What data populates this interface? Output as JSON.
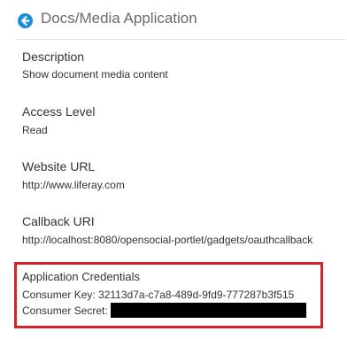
{
  "header": {
    "title": "Docs/Media Application",
    "back_icon": "back-arrow-circle-icon",
    "accent_color": "#1a8fd8"
  },
  "fields": [
    {
      "label": "Description",
      "value": "Show document media content"
    },
    {
      "label": "Access Level",
      "value": "Read"
    },
    {
      "label": "Website URL",
      "value": "http://www.liferay.com"
    },
    {
      "label": "Callback URI",
      "value": "http://localhost:8080/opensocial-portlet/gadgets/oauthcallback"
    }
  ],
  "credentials": {
    "title": "Application Credentials",
    "consumer_key_label": "Consumer Key:",
    "consumer_key_value": "32113d7a-c7a8-489d-9fd9-777287b3f515",
    "consumer_secret_label": "Consumer Secret:",
    "highlight_color": "#d6202a"
  }
}
